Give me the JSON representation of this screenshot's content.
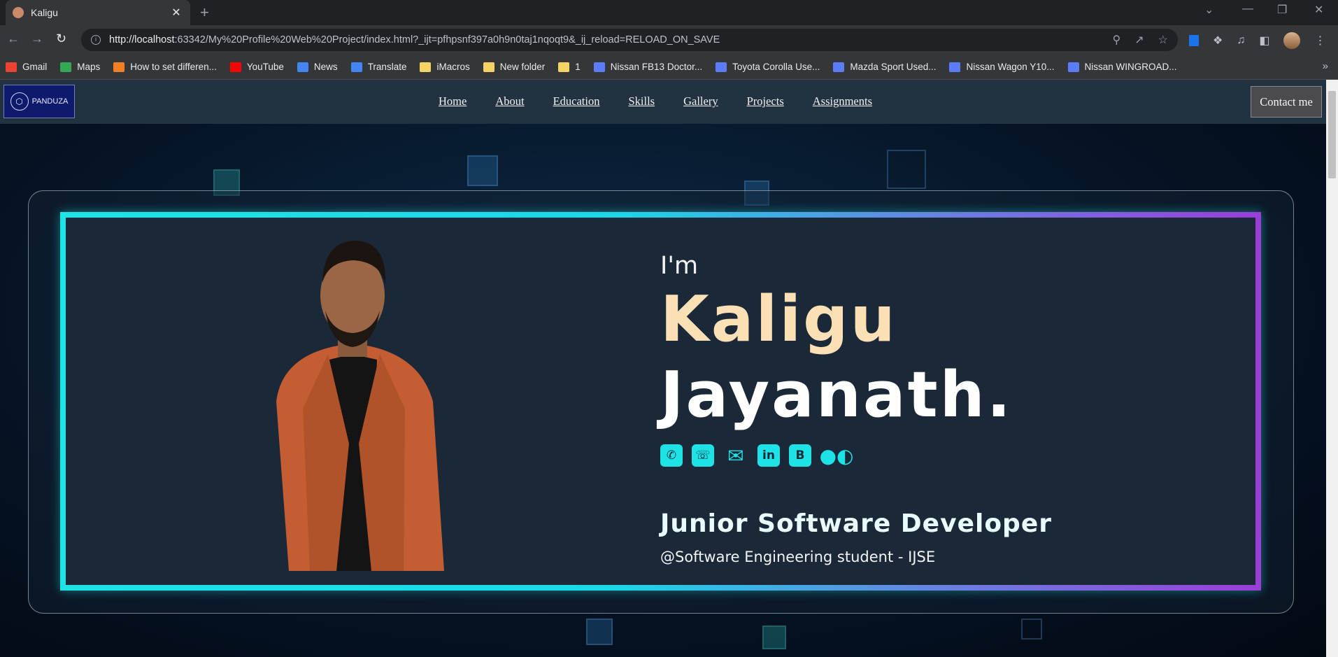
{
  "browser": {
    "tab_title": "Kaligu",
    "tab_close": "✕",
    "new_tab": "+",
    "url_host": "http://localhost",
    "url_rest": ":63342/My%20Profile%20Web%20Project/index.html?_ijt=pfhpsnf397a0h9n0taj1nqoqt9&_ij_reload=RELOAD_ON_SAVE",
    "window_controls": [
      "⌄",
      "—",
      "❐",
      "✕"
    ]
  },
  "bookmarks": [
    {
      "label": "Gmail",
      "color": "#ea4335"
    },
    {
      "label": "Maps",
      "color": "#34a853"
    },
    {
      "label": "How to set differen...",
      "color": "#f48024"
    },
    {
      "label": "YouTube",
      "color": "#ff0000"
    },
    {
      "label": "News",
      "color": "#4285f4"
    },
    {
      "label": "Translate",
      "color": "#4285f4"
    },
    {
      "label": "iMacros",
      "color": "#f6d365"
    },
    {
      "label": "New folder",
      "color": "#f6d365"
    },
    {
      "label": "1",
      "color": "#f6d365"
    },
    {
      "label": "Nissan FB13 Doctor...",
      "color": "#5c7cfa"
    },
    {
      "label": "Toyota Corolla Use...",
      "color": "#5c7cfa"
    },
    {
      "label": "Mazda Sport Used...",
      "color": "#5c7cfa"
    },
    {
      "label": "Nissan Wagon Y10...",
      "color": "#5c7cfa"
    },
    {
      "label": "Nissan WINGROAD...",
      "color": "#5c7cfa"
    }
  ],
  "bookmarks_more": "»",
  "site": {
    "logo_text": "PANDUZA",
    "nav": [
      "Home",
      "About",
      "Education",
      "Skills",
      "Gallery",
      "Projects",
      "Assignments"
    ],
    "contact_label": "Contact me"
  },
  "hero": {
    "intro": "I'm",
    "first_name": "Kaligu",
    "last_name": "Jayanath.",
    "role": "Junior Software Developer",
    "subtitle": "@Software Engineering student - IJSE",
    "social_icons": [
      "phone-icon",
      "whatsapp-icon",
      "email-icon",
      "linkedin-icon",
      "blogger-icon",
      "medium-icon"
    ]
  },
  "colors": {
    "accent_cyan": "#1de3e7",
    "accent_purple": "#9a3ed8",
    "first_name": "#fbe0b6"
  }
}
